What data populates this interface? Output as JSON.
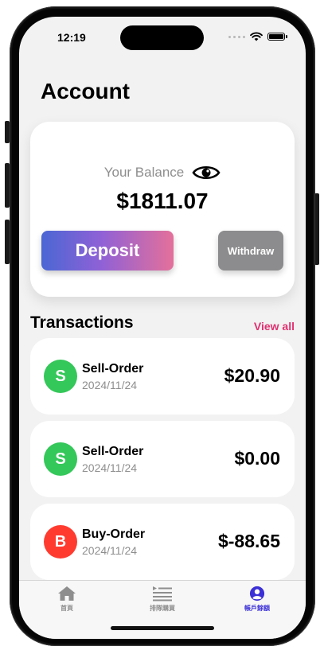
{
  "status_bar": {
    "time": "12:19"
  },
  "header": {
    "title": "Account"
  },
  "balance": {
    "label": "Your Balance",
    "amount": "$1811.07",
    "deposit_label": "Deposit",
    "withdraw_label": "Withdraw"
  },
  "transactions": {
    "title": "Transactions",
    "view_all": "View all",
    "items": [
      {
        "initial": "S",
        "name": "Sell-Order",
        "date": "2024/11/24",
        "amount": "$20.90",
        "badge_color": "#34c759"
      },
      {
        "initial": "S",
        "name": "Sell-Order",
        "date": "2024/11/24",
        "amount": "$0.00",
        "badge_color": "#34c759"
      },
      {
        "initial": "B",
        "name": "Buy-Order",
        "date": "2024/11/24",
        "amount": "$-88.65",
        "badge_color": "#ff3b30"
      }
    ]
  },
  "tabbar": {
    "tabs": [
      {
        "label": "首頁",
        "icon": "house-icon",
        "active": false
      },
      {
        "label": "排隊購買",
        "icon": "list-icon",
        "active": false
      },
      {
        "label": "帳戶餘額",
        "icon": "person-icon",
        "active": true
      }
    ]
  },
  "colors": {
    "accent": "#e0306f",
    "active_tab": "#3b2fd6",
    "deposit_gradient": [
      "#4a67d4",
      "#8f61d6",
      "#e4709a"
    ],
    "withdraw": "#8c8c8e"
  }
}
